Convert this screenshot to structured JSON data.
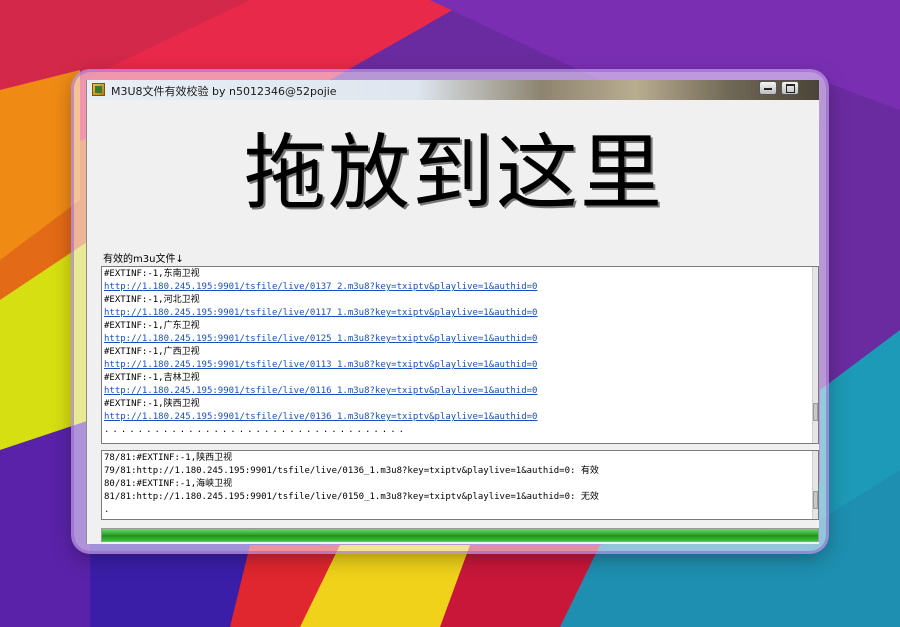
{
  "window": {
    "title": "M3U8文件有效校验 by n5012346@52pojie"
  },
  "drop_zone": {
    "text": "拖放到这里"
  },
  "valid_files": {
    "label": "有效的m3u文件↓",
    "lines": [
      {
        "text": "#EXTINF:-1,东南卫视",
        "kind": "info"
      },
      {
        "text": "http://1.180.245.195:9901/tsfile/live/0137_2.m3u8?key=txiptv&playlive=1&authid=0",
        "kind": "url"
      },
      {
        "text": "#EXTINF:-1,河北卫视",
        "kind": "info"
      },
      {
        "text": "http://1.180.245.195:9901/tsfile/live/0117_1.m3u8?key=txiptv&playlive=1&authid=0",
        "kind": "url"
      },
      {
        "text": "#EXTINF:-1,广东卫视",
        "kind": "info"
      },
      {
        "text": "http://1.180.245.195:9901/tsfile/live/0125_1.m3u8?key=txiptv&playlive=1&authid=0",
        "kind": "url"
      },
      {
        "text": "#EXTINF:-1,广西卫视",
        "kind": "info"
      },
      {
        "text": "http://1.180.245.195:9901/tsfile/live/0113_1.m3u8?key=txiptv&playlive=1&authid=0",
        "kind": "url"
      },
      {
        "text": "#EXTINF:-1,吉林卫视",
        "kind": "info"
      },
      {
        "text": "http://1.180.245.195:9901/tsfile/live/0116_1.m3u8?key=txiptv&playlive=1&authid=0",
        "kind": "url"
      },
      {
        "text": "#EXTINF:-1,陕西卫视",
        "kind": "info"
      },
      {
        "text": "http://1.180.245.195:9901/tsfile/live/0136_1.m3u8?key=txiptv&playlive=1&authid=0",
        "kind": "url"
      },
      {
        "text": "....................................",
        "kind": "dots"
      }
    ]
  },
  "log": {
    "lines": [
      "78/81:#EXTINF:-1,陕西卫视",
      "79/81:http://1.180.245.195:9901/tsfile/live/0136_1.m3u8?key=txiptv&playlive=1&authid=0: 有效",
      "80/81:#EXTINF:-1,海峡卫视",
      "81/81:http://1.180.245.195:9901/tsfile/live/0150_1.m3u8?key=txiptv&playlive=1&authid=0: 无效",
      "."
    ]
  },
  "progress": {
    "percent": 100,
    "color": "#2fa82f"
  },
  "icons": [
    "app-icon",
    "minimize-icon",
    "maximize-icon"
  ]
}
